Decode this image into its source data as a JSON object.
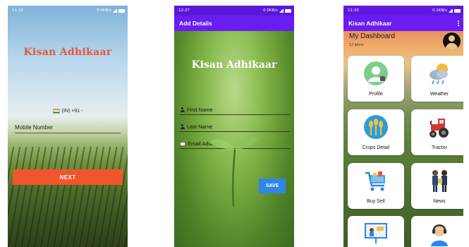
{
  "screens": {
    "login": {
      "status": {
        "time": "11:32",
        "speed": "0.0KB/s"
      },
      "brand": "Kisan Adhikaar",
      "country_code": "(IN) +91 -",
      "mobile_label": "Mobile Number",
      "next_label": "NEXT"
    },
    "details": {
      "status": {
        "time": "12:27",
        "speed": "0.0KB/s"
      },
      "title": "Add Details",
      "brand": "Kisan Adhikaar",
      "first_name": "First Name",
      "last_name": "Last Name",
      "email": "Email Address",
      "save_label": "SAVE"
    },
    "dashboard": {
      "status": {
        "time": "11:33",
        "speed": "0.1KB/s"
      },
      "title": "Kisan Adhikaar",
      "heading": "My Dashboard",
      "subheading": "12 items",
      "tiles": [
        "Profile",
        "Weather",
        "Crops Detail",
        "Tractor",
        "Buy Sell",
        "News",
        "",
        ""
      ]
    }
  },
  "colors": {
    "appbar": "#6a1cf2",
    "next_button": "#f2542d",
    "save_button": "#2f86e6",
    "brand_orange": "#e8563a"
  },
  "icons": [
    "flag-india-icon",
    "person-icon",
    "mail-icon",
    "kebab-menu-icon",
    "profile-icon",
    "weather-icon",
    "crops-icon",
    "tractor-icon",
    "cart-icon",
    "news-icon",
    "presentation-icon",
    "support-icon",
    "avatar-icon"
  ],
  "battery_level": 1.0
}
